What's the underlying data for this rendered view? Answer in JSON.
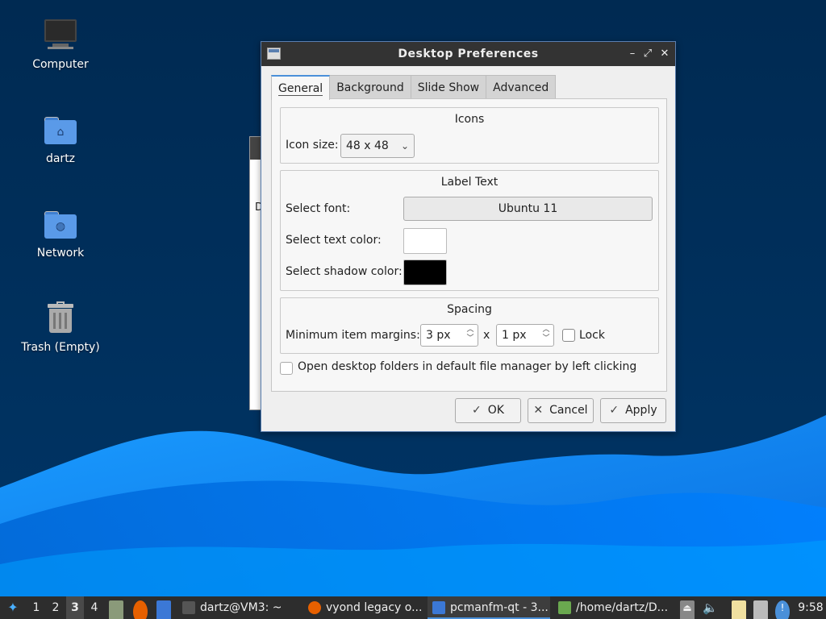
{
  "desktop": {
    "icons": [
      {
        "label": "Computer",
        "glyph": "computer-icon"
      },
      {
        "label": "dartz",
        "glyph": "home-folder-icon"
      },
      {
        "label": "Network",
        "glyph": "network-folder-icon"
      },
      {
        "label": "Trash (Empty)",
        "glyph": "trash-icon"
      }
    ],
    "bg_window_peek": "D"
  },
  "dialog": {
    "title": "Desktop Preferences",
    "controls": {
      "minimize": "–",
      "maximize": "⤢",
      "close": "✕"
    },
    "tabs": [
      {
        "label": "General",
        "active": true
      },
      {
        "label": "Background",
        "active": false
      },
      {
        "label": "Slide Show",
        "active": false
      },
      {
        "label": "Advanced",
        "active": false
      }
    ],
    "icons_group": {
      "title": "Icons",
      "icon_size_label": "Icon size:",
      "icon_size_value": "48 x 48"
    },
    "label_text_group": {
      "title": "Label Text",
      "font_label": "Select font:",
      "font_value": "Ubuntu 11",
      "text_color_label": "Select text color:",
      "text_color": "#ffffff",
      "shadow_color_label": "Select shadow color:",
      "shadow_color": "#000000"
    },
    "spacing_group": {
      "title": "Spacing",
      "margins_label": "Minimum item margins:",
      "margin_x": "3 px",
      "separator": "x",
      "margin_y": "1 px",
      "lock_label": "Lock",
      "lock_checked": false
    },
    "open_folders_label": "Open desktop folders in default file manager by left clicking",
    "open_folders_checked": false,
    "buttons": {
      "ok": "OK",
      "cancel": "Cancel",
      "apply": "Apply"
    }
  },
  "taskbar": {
    "desktops": [
      "1",
      "2",
      "3",
      "4"
    ],
    "active_desktop": "3",
    "tasks": [
      {
        "label": "dartz@VM3: ~",
        "icon": "terminal-icon"
      },
      {
        "label": "vyond legacy o...",
        "icon": "firefox-icon"
      },
      {
        "label": "pcmanfm-qt - 3...",
        "icon": "folder-icon",
        "active": true
      },
      {
        "label": "/home/dartz/D...",
        "icon": "archive-icon"
      }
    ],
    "clock": "9:58"
  },
  "colors": {
    "accent": "#4a90d9",
    "wallpaper_dark": "#002a52",
    "wave_light": "#1a8cff",
    "wave_mid": "#0066d6"
  }
}
